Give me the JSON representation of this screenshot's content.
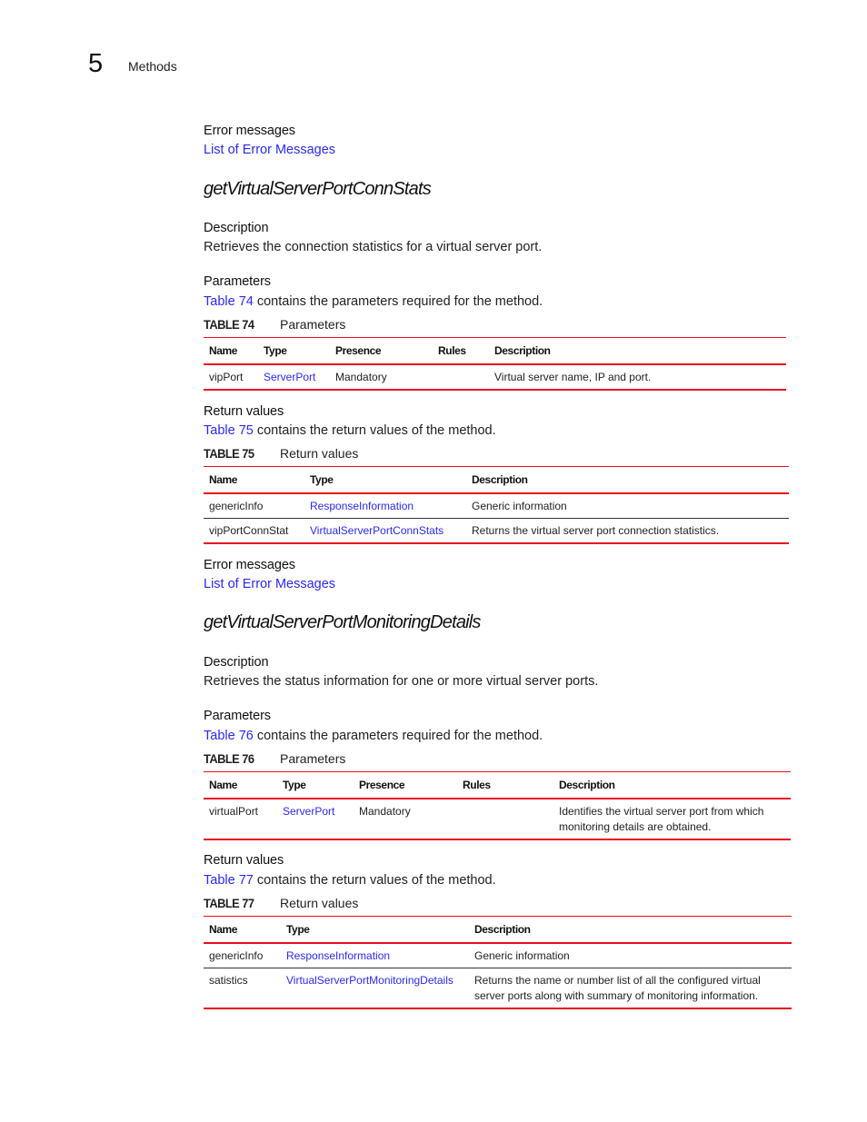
{
  "header": {
    "chapter_number": "5",
    "chapter_title": "Methods"
  },
  "top_error": {
    "heading": "Error messages",
    "link": "List of Error Messages"
  },
  "method1": {
    "title": "getVirtualServerPortConnStats",
    "description_heading": "Description",
    "description": "Retrieves the connection statistics for a virtual server port.",
    "parameters_heading": "Parameters",
    "parameters_ref": "Table 74",
    "parameters_text": " contains the parameters required for the method.",
    "table74": {
      "label": "TABLE 74",
      "caption": "Parameters",
      "headers": [
        "Name",
        "Type",
        "Presence",
        "Rules",
        "Description"
      ],
      "rows": [
        {
          "name": "vipPort",
          "type": "ServerPort",
          "presence": "Mandatory",
          "rules": "",
          "description": "Virtual server name, IP and port."
        }
      ]
    },
    "return_heading": "Return values",
    "return_ref": "Table 75",
    "return_text": " contains the return values of the method.",
    "table75": {
      "label": "TABLE 75",
      "caption": "Return values",
      "headers": [
        "Name",
        "Type",
        "Description"
      ],
      "rows": [
        {
          "name": "genericInfo",
          "type": "ResponseInformation",
          "description": "Generic information"
        },
        {
          "name": "vipPortConnStat",
          "type": "VirtualServerPortConnStats",
          "description": "Returns the virtual server port connection statistics."
        }
      ]
    },
    "error_heading": "Error messages",
    "error_link": "List of Error Messages"
  },
  "method2": {
    "title": "getVirtualServerPortMonitoringDetails",
    "description_heading": "Description",
    "description": "Retrieves the status information for one or more virtual server ports.",
    "parameters_heading": "Parameters",
    "parameters_ref": "Table 76",
    "parameters_text": " contains the parameters required for the method.",
    "table76": {
      "label": "TABLE 76",
      "caption": "Parameters",
      "headers": [
        "Name",
        "Type",
        "Presence",
        "Rules",
        "Description"
      ],
      "rows": [
        {
          "name": "virtualPort",
          "type": "ServerPort",
          "presence": "Mandatory",
          "rules": "",
          "description": "Identifies the virtual server port from which monitoring details are obtained."
        }
      ]
    },
    "return_heading": "Return values",
    "return_ref": "Table 77",
    "return_text": " contains the return values of the method.",
    "table77": {
      "label": "TABLE 77",
      "caption": "Return values",
      "headers": [
        "Name",
        "Type",
        "Description"
      ],
      "rows": [
        {
          "name": "genericInfo",
          "type": "ResponseInformation",
          "description": "Generic information"
        },
        {
          "name": "satistics",
          "type": "VirtualServerPortMonitoringDetails",
          "description": "Returns the name or number list of all the configured virtual server ports along with summary of monitoring information."
        }
      ]
    }
  },
  "colors": {
    "link": "#2a2af0",
    "rule_red": "#e8101e",
    "text": "#222222"
  }
}
